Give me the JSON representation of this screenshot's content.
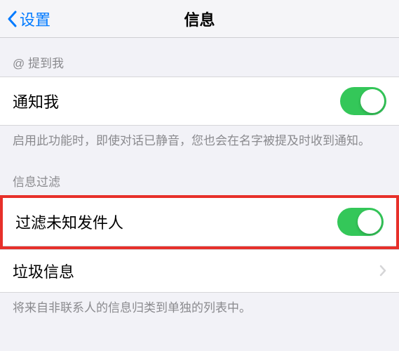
{
  "navbar": {
    "back_label": "设置",
    "title": "信息"
  },
  "mentions_section": {
    "header": "@ 提到我",
    "notify_me_label": "通知我",
    "footer": "启用此功能时，即使对话已静音，您也会在名字被提及时收到通知。"
  },
  "filter_section": {
    "header": "信息过滤",
    "filter_unknown_label": "过滤未知发件人",
    "junk_label": "垃圾信息",
    "footer": "将来自非联系人的信息归类到单独的列表中。"
  },
  "colors": {
    "accent": "#007aff",
    "toggle_on": "#34c759",
    "highlight_border": "#e7302a"
  }
}
